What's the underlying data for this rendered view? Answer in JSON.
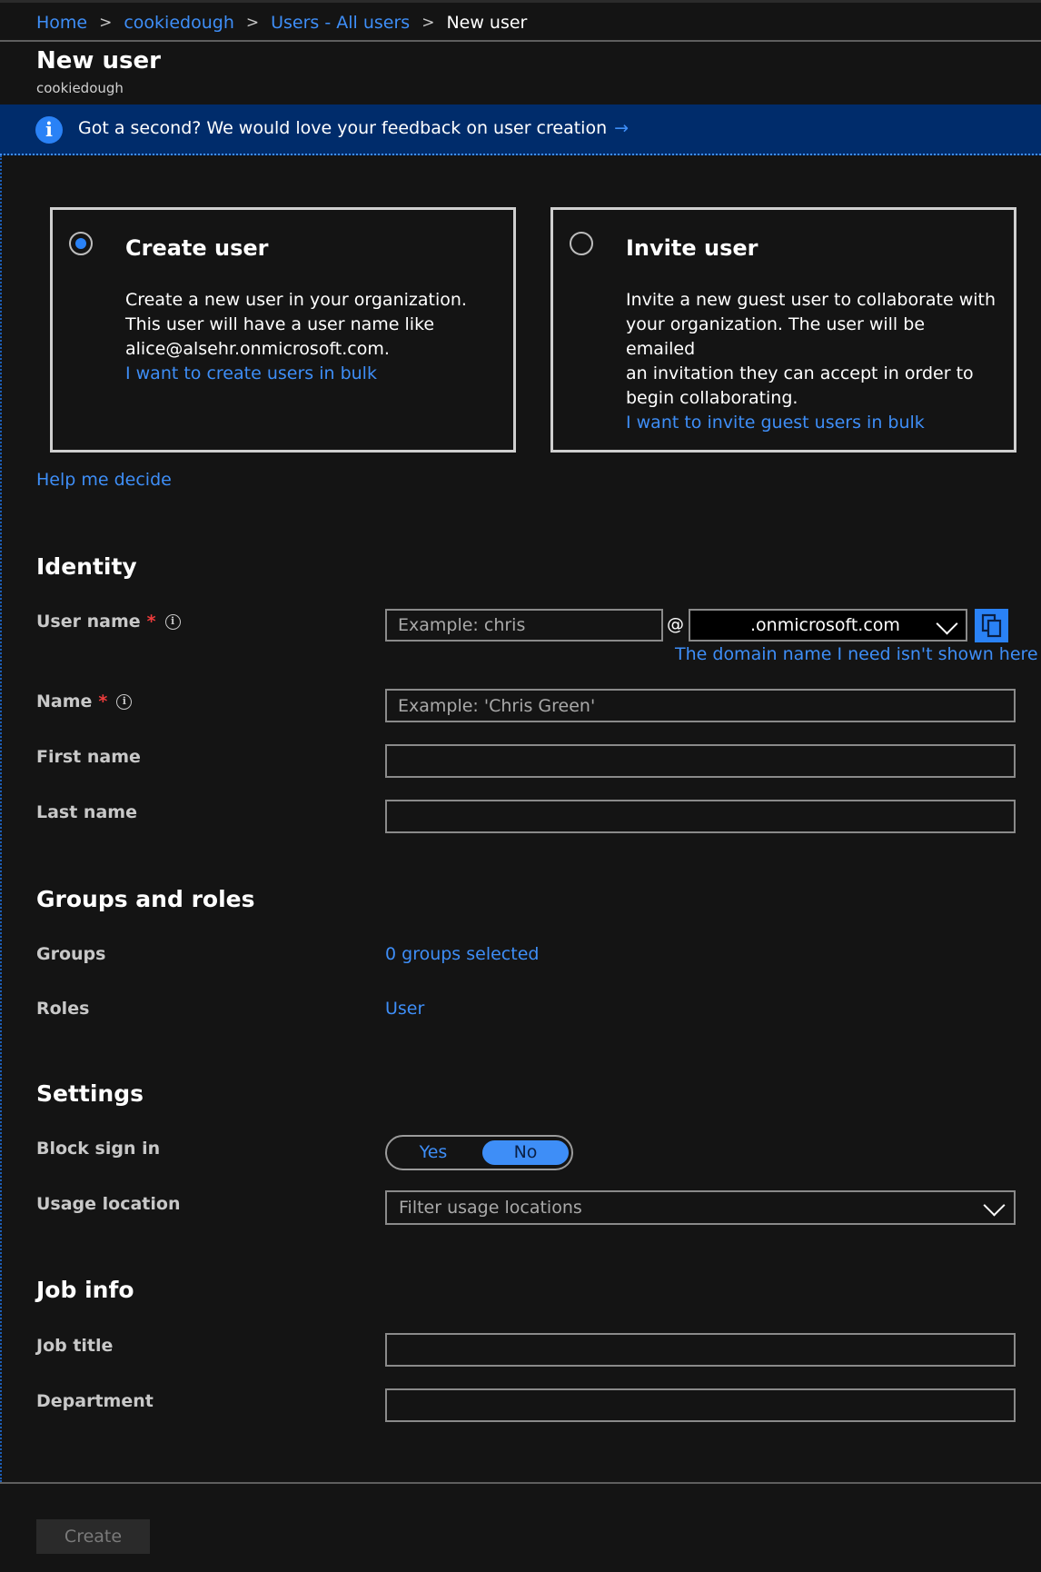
{
  "breadcrumb": {
    "home": "Home",
    "tenant": "cookiedough",
    "users": "Users - All users",
    "current": "New user"
  },
  "header": {
    "title": "New user",
    "subtitle": "cookiedough"
  },
  "banner": {
    "text": "Got a second? We would love your feedback on user creation",
    "arrow": "→",
    "icon": "info-icon"
  },
  "options": {
    "create": {
      "title": "Create user",
      "line1": "Create a new user in your organization.",
      "line2": "This user will have a user name like",
      "line3": "alice@alsehr.onmicrosoft.com.",
      "link": "I want to create users in bulk",
      "selected": true
    },
    "invite": {
      "title": "Invite user",
      "line1": "Invite a new guest user to collaborate with",
      "line2": "your organization. The user will be emailed",
      "line3": "an invitation they can accept in order to",
      "line4": "begin collaborating.",
      "link": "I want to invite guest users in bulk",
      "selected": false
    }
  },
  "help_link": "Help me decide",
  "identity": {
    "heading": "Identity",
    "username_label": "User name",
    "username_placeholder": "Example: chris",
    "at_sign": "@",
    "domain_value": ".onmicrosoft.com",
    "domain_link": "The domain name I need isn't shown here",
    "name_label": "Name",
    "name_placeholder": "Example: 'Chris Green'",
    "first_name_label": "First name",
    "last_name_label": "Last name",
    "required_mark": "*",
    "info_mark": "i"
  },
  "groups_roles": {
    "heading": "Groups and roles",
    "groups_label": "Groups",
    "groups_value": "0 groups selected",
    "roles_label": "Roles",
    "roles_value": "User"
  },
  "settings": {
    "heading": "Settings",
    "block_label": "Block sign in",
    "toggle_yes": "Yes",
    "toggle_no": "No",
    "toggle_selected": "No",
    "usage_label": "Usage location",
    "usage_placeholder": "Filter usage locations"
  },
  "job": {
    "heading": "Job info",
    "title_label": "Job title",
    "department_label": "Department"
  },
  "footer": {
    "create_button": "Create"
  },
  "colors": {
    "accent": "#3e8ef7",
    "banner": "#002c6b",
    "background": "#141414",
    "required": "#ee3c3c"
  }
}
